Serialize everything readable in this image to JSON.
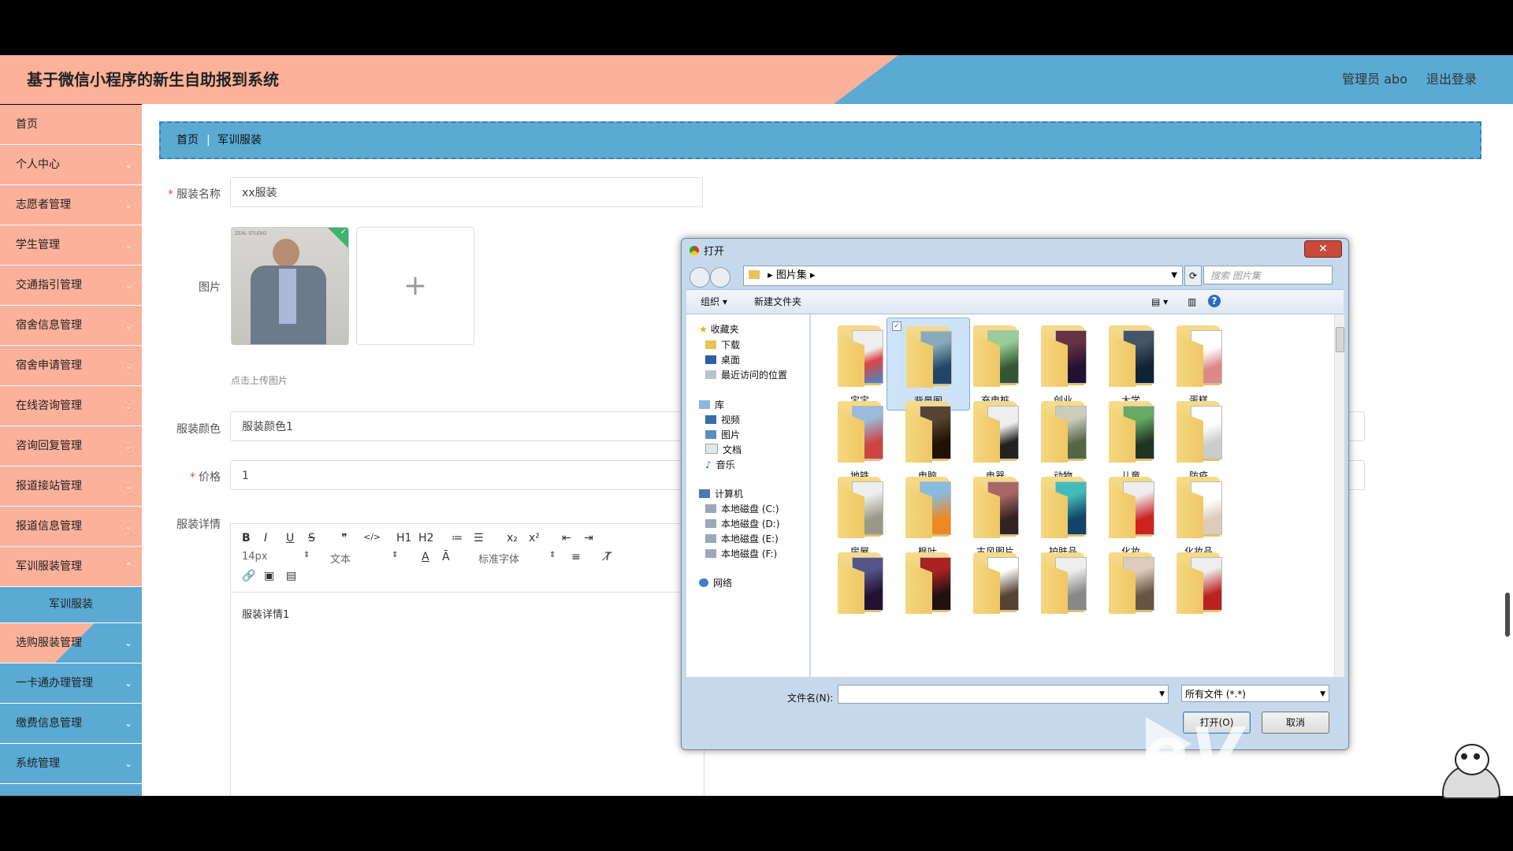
{
  "header": {
    "title": "基于微信小程序的新生自助报到系统",
    "admin": "管理员 abo",
    "logout": "退出登录"
  },
  "sidebar": {
    "items": [
      {
        "label": "首页"
      },
      {
        "label": "个人中心"
      },
      {
        "label": "志愿者管理"
      },
      {
        "label": "学生管理"
      },
      {
        "label": "交通指引管理"
      },
      {
        "label": "宿舍信息管理"
      },
      {
        "label": "宿舍申请管理"
      },
      {
        "label": "在线咨询管理"
      },
      {
        "label": "咨询回复管理"
      },
      {
        "label": "报道接站管理"
      },
      {
        "label": "报道信息管理"
      },
      {
        "label": "军训服装管理"
      },
      {
        "label": "选购服装管理"
      },
      {
        "label": "一卡通办理管理"
      },
      {
        "label": "缴费信息管理"
      },
      {
        "label": "系统管理"
      }
    ],
    "submenu": "军训服装"
  },
  "breadcrumb": {
    "home": "首页",
    "separator": "|",
    "current": "军训服装"
  },
  "form": {
    "name_label": "服装名称",
    "name_value": "xx服装",
    "image_label": "图片",
    "thumb_caption": "ZEAL STUDIO",
    "image_hint": "点击上传图片",
    "color_label": "服装颜色",
    "color_value": "服装颜色1",
    "price_label": "价格",
    "price_value": "1",
    "detail_label": "服装详情",
    "detail_value": "服装详情1"
  },
  "editor": {
    "font_size": "14px",
    "paragraph": "文本",
    "font_family": "标准字体",
    "buttons": [
      "B",
      "I",
      "U",
      "S",
      "❞",
      "</>",
      "H1",
      "H2",
      "≔",
      "☰",
      "x₂",
      "x²",
      "⇤",
      "⇥"
    ]
  },
  "dialog": {
    "title": "打开",
    "close": "✕",
    "path": "图片集",
    "search_placeholder": "搜索 图片集",
    "organize": "组织 ▾",
    "new_folder": "新建文件夹",
    "nav": {
      "favorites": "收藏夹",
      "downloads": "下载",
      "desktop": "桌面",
      "recent": "最近访问的位置",
      "libraries": "库",
      "videos": "视频",
      "pictures": "图片",
      "documents": "文档",
      "music": "音乐",
      "computer": "计算机",
      "disk_c": "本地磁盘 (C:)",
      "disk_d": "本地磁盘 (D:)",
      "disk_e": "本地磁盘 (E:)",
      "disk_f": "本地磁盘 (F:)",
      "network": "网络"
    },
    "folders": [
      "宝宝",
      "背景图",
      "充电桩",
      "创业",
      "大学",
      "蛋糕",
      "地铁",
      "电脑",
      "电器",
      "动物",
      "儿童",
      "防疫",
      "房屋",
      "枫叶",
      "古风图片",
      "护肤品",
      "化妆",
      "化妆品",
      "",
      "",
      "",
      "",
      "",
      ""
    ],
    "selected_folder": "背景图",
    "filename_label": "文件名(N):",
    "filetype": "所有文件 (*.*)",
    "open_button": "打开(O)",
    "cancel_button": "取消"
  },
  "watermark": "eV"
}
